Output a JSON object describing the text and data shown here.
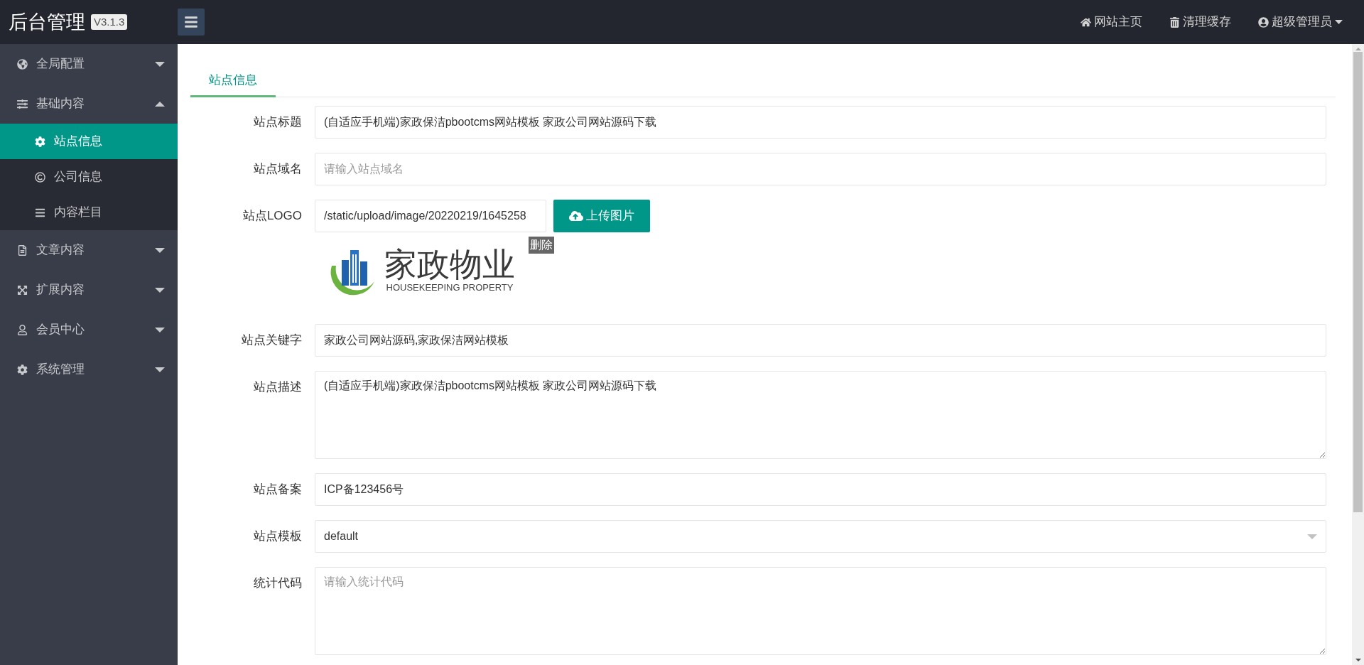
{
  "header": {
    "title": "后台管理",
    "version": "V3.1.3",
    "links": [
      {
        "label": "网站主页",
        "dropdown": false
      },
      {
        "label": "清理缓存",
        "dropdown": false
      },
      {
        "label": "超级管理员",
        "dropdown": true
      }
    ]
  },
  "sidebar": {
    "items": [
      {
        "label": "全局配置",
        "expanded": false
      },
      {
        "label": "基础内容",
        "expanded": true,
        "children": [
          {
            "label": "站点信息",
            "selected": true
          },
          {
            "label": "公司信息",
            "selected": false
          },
          {
            "label": "内容栏目",
            "selected": false
          }
        ]
      },
      {
        "label": "文章内容",
        "expanded": false
      },
      {
        "label": "扩展内容",
        "expanded": false
      },
      {
        "label": "会员中心",
        "expanded": false
      },
      {
        "label": "系统管理",
        "expanded": false
      }
    ]
  },
  "tabs": [
    {
      "label": "站点信息",
      "selected": true
    }
  ],
  "form": {
    "fields": [
      {
        "kind": "text",
        "label": "站点标题",
        "value": "(自适应手机端)家政保洁pbootcms网站模板 家政公司网站源码下载"
      },
      {
        "kind": "text",
        "label": "站点域名",
        "placeholder": "请输入站点域名"
      },
      {
        "kind": "upload",
        "label": "站点LOGO",
        "value": "/static/upload/image/20220219/1645258",
        "button": "上传图片",
        "delete": "删除",
        "logo": {
          "title": "家政物业",
          "subtitle": "HOUSEKEEPING PROPERTY"
        }
      },
      {
        "kind": "text",
        "label": "站点关键字",
        "value": "家政公司网站源码,家政保洁网站模板"
      },
      {
        "kind": "textarea",
        "label": "站点描述",
        "value": "(自适应手机端)家政保洁pbootcms网站模板 家政公司网站源码下载"
      },
      {
        "kind": "text",
        "label": "站点备案",
        "value": "ICP备123456号"
      },
      {
        "kind": "select",
        "label": "站点模板",
        "value": "default"
      },
      {
        "kind": "textarea",
        "label": "统计代码",
        "placeholder": "请输入统计代码"
      }
    ]
  }
}
